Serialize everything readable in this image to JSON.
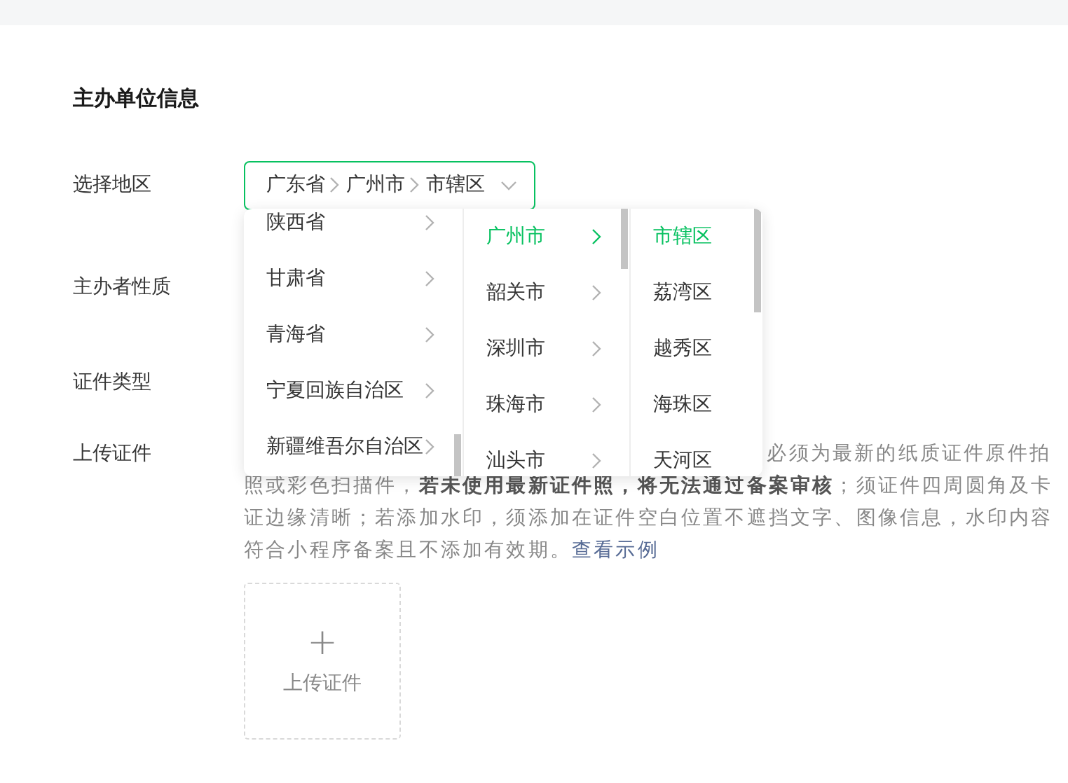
{
  "section_title": "主办单位信息",
  "fields": [
    {
      "label": "选择地区",
      "kind": "region"
    },
    {
      "label": "主办者性质",
      "kind": "plain"
    },
    {
      "label": "证件类型",
      "kind": "plain"
    },
    {
      "label": "上传证件",
      "kind": "upload"
    }
  ],
  "region_select": {
    "path": [
      "广东省",
      "广州市",
      "市辖区"
    ],
    "expanded": true
  },
  "cascader": [
    [
      {
        "label": "陕西省",
        "selected": false
      },
      {
        "label": "甘肃省",
        "selected": false
      },
      {
        "label": "青海省",
        "selected": false
      },
      {
        "label": "宁夏回族自治区",
        "selected": false
      },
      {
        "label": "新疆维吾尔自治区",
        "selected": false
      }
    ],
    [
      {
        "label": "广州市",
        "selected": true
      },
      {
        "label": "韶关市",
        "selected": false
      },
      {
        "label": "深圳市",
        "selected": false
      },
      {
        "label": "珠海市",
        "selected": false
      },
      {
        "label": "汕头市",
        "selected": false
      }
    ],
    [
      {
        "label": "市辖区",
        "selected": true
      },
      {
        "label": "荔湾区",
        "selected": false
      },
      {
        "label": "越秀区",
        "selected": false
      },
      {
        "label": "海珠区",
        "selected": false
      },
      {
        "label": "天河区",
        "selected": false
      }
    ]
  ],
  "upload_hint": {
    "first_line_visible": "必须为最新的纸质证件原件拍",
    "lines": [
      "照或彩色扫描件，**若未使用最新证件照，将无法通过备案审核**；须证件四周圆角及卡",
      "证边缘清晰；若添加水印，须添加在证件空白位置不遮挡文字、图像信息，水印内容",
      "符合小程序备案且不添加有效期。"
    ],
    "link": "查看示例"
  },
  "upload_button": {
    "icon": "+",
    "label": "上传证件"
  }
}
